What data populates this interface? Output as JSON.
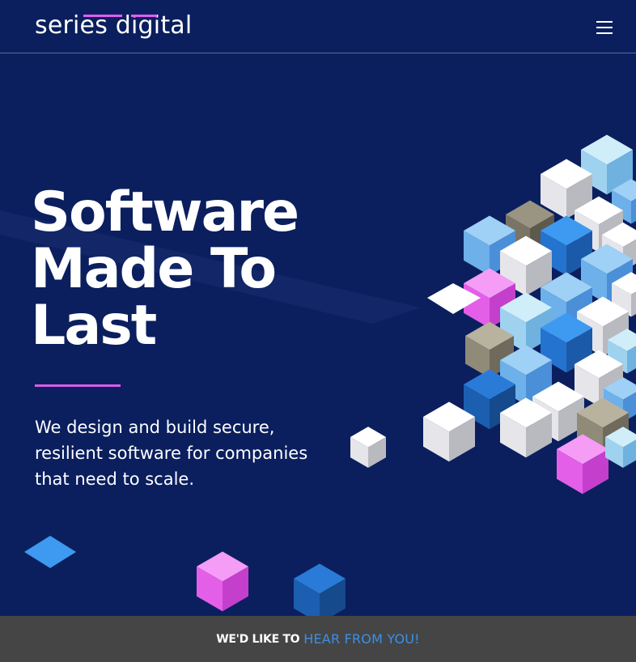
{
  "header": {
    "logo_text": "series digital",
    "menu_icon": "hamburger-menu-icon"
  },
  "hero": {
    "title_lines": [
      "Software",
      "Made To",
      "Last"
    ],
    "subtitle": "We design and build secure, resilient software for companies that need to scale."
  },
  "footer": {
    "lead": "WE'D LIKE TO",
    "highlight": "HEAR FROM YOU!"
  },
  "colors": {
    "background": "#0b1f5e",
    "accent_pink": "#e05cf0",
    "accent_blue": "#3d8ee6",
    "footer_bg": "#454545"
  }
}
